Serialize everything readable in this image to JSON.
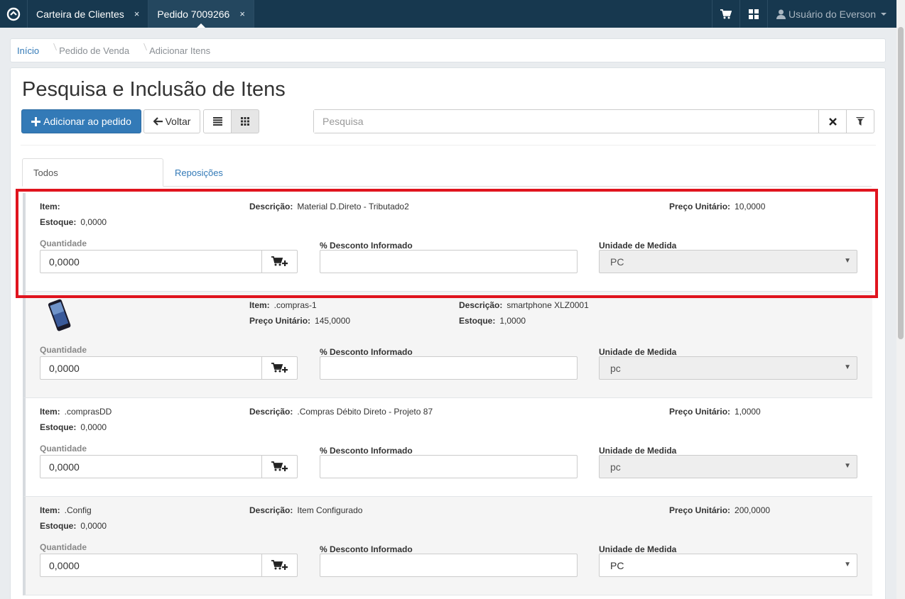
{
  "topbar": {
    "tabs": [
      {
        "label": "Carteira de Clientes",
        "close": "×"
      },
      {
        "label": "Pedido 7009266",
        "close": "×"
      }
    ],
    "user_label": "Usuário do Everson"
  },
  "breadcrumb": [
    "Início",
    "Pedido de Venda",
    "Adicionar Itens"
  ],
  "page_title": "Pesquisa e Inclusão de Itens",
  "toolbar": {
    "add_label": "Adicionar ao pedido",
    "back_label": "Voltar",
    "search_placeholder": "Pesquisa"
  },
  "tabs": [
    "Todos",
    "Reposições"
  ],
  "labels": {
    "item": "Item:",
    "descricao": "Descrição:",
    "preco": "Preço Unitário:",
    "estoque": "Estoque:",
    "quantidade": "Quantidade",
    "desconto": "% Desconto Informado",
    "unidade": "Unidade de Medida"
  },
  "items": [
    {
      "item": "",
      "descricao": "Material D.Direto - Tributado2",
      "preco": "10,0000",
      "estoque": "0,0000",
      "quantidade": "0,0000",
      "unidade": "PC"
    },
    {
      "item": ".compras-1",
      "descricao": "smartphone XLZ0001",
      "preco": "145,0000",
      "estoque": "1,0000",
      "quantidade": "0,0000",
      "unidade": "pc"
    },
    {
      "item": ".comprasDD",
      "descricao": ".Compras Débito Direto - Projeto 87",
      "preco": "1,0000",
      "estoque": "0,0000",
      "quantidade": "0,0000",
      "unidade": "pc"
    },
    {
      "item": ".Config",
      "descricao": "Item Configurado",
      "preco": "200,0000",
      "estoque": "0,0000",
      "quantidade": "0,0000",
      "unidade": "PC"
    }
  ],
  "colors": {
    "topbar": "#17384f",
    "primary": "#337ab7",
    "highlight": "#e0141e"
  }
}
